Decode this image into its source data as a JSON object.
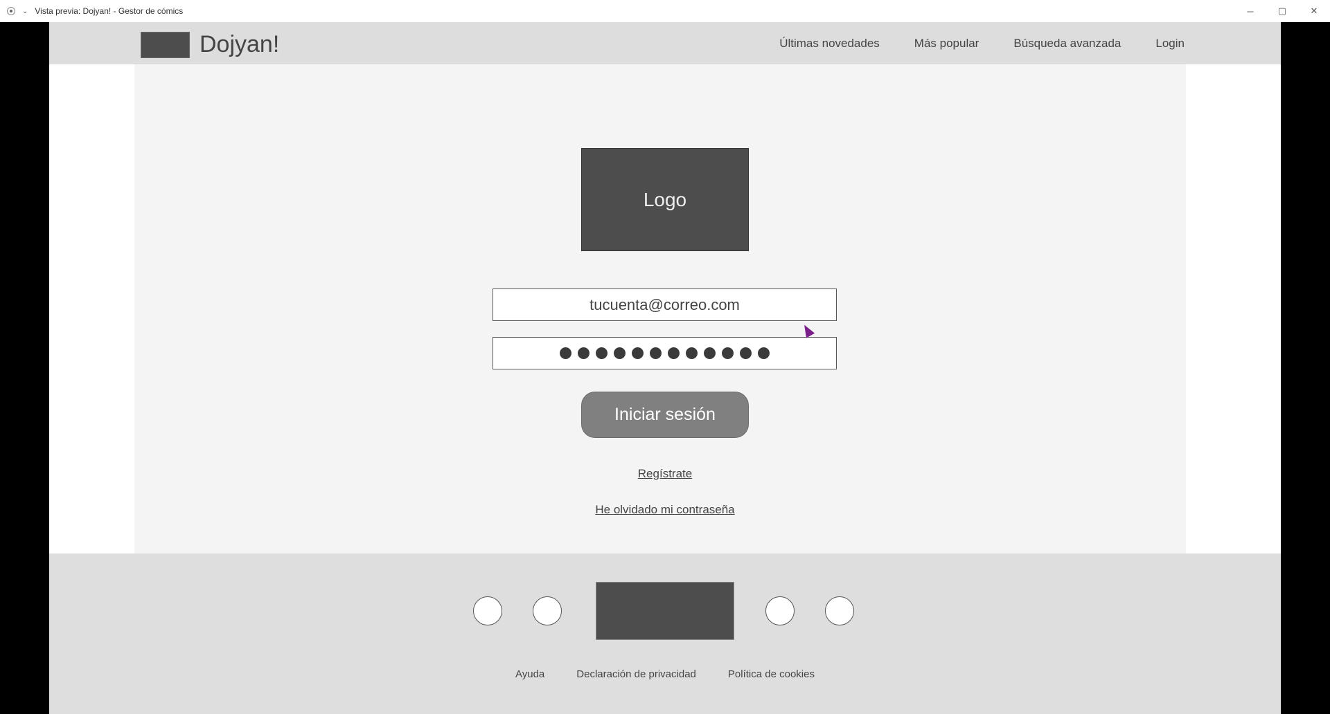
{
  "window": {
    "title": "Vista previa: Dojyan! - Gestor de cómics",
    "controls": [
      "─",
      "▢",
      "✕"
    ]
  },
  "header": {
    "brand_name": "Dojyan!",
    "nav": [
      {
        "label": "Últimas novedades"
      },
      {
        "label": "Más popular"
      },
      {
        "label": "Búsqueda avanzada"
      },
      {
        "label": "Login"
      }
    ]
  },
  "login": {
    "logo_label": "Logo",
    "email_value": "tucuenta@correo.com",
    "password_masked_length": 12,
    "submit_label": "Iniciar sesión",
    "register_label": "Regístrate",
    "forgot_label": "He olvidado mi contraseña"
  },
  "footer": {
    "links": [
      {
        "label": "Ayuda"
      },
      {
        "label": "Declaración de privacidad"
      },
      {
        "label": "Política de cookies"
      }
    ]
  },
  "icons": {
    "app": "app-circle-icon",
    "dropdown": "chevron-down-icon",
    "cursor": "mouse-cursor-icon"
  },
  "colors": {
    "nav_bg": "#dddddd",
    "panel_bg": "#f4f4f4",
    "footer_bg": "#dedede",
    "dark_block": "#4d4d4d",
    "button": "#808080",
    "cursor": "#7a1f8a"
  }
}
